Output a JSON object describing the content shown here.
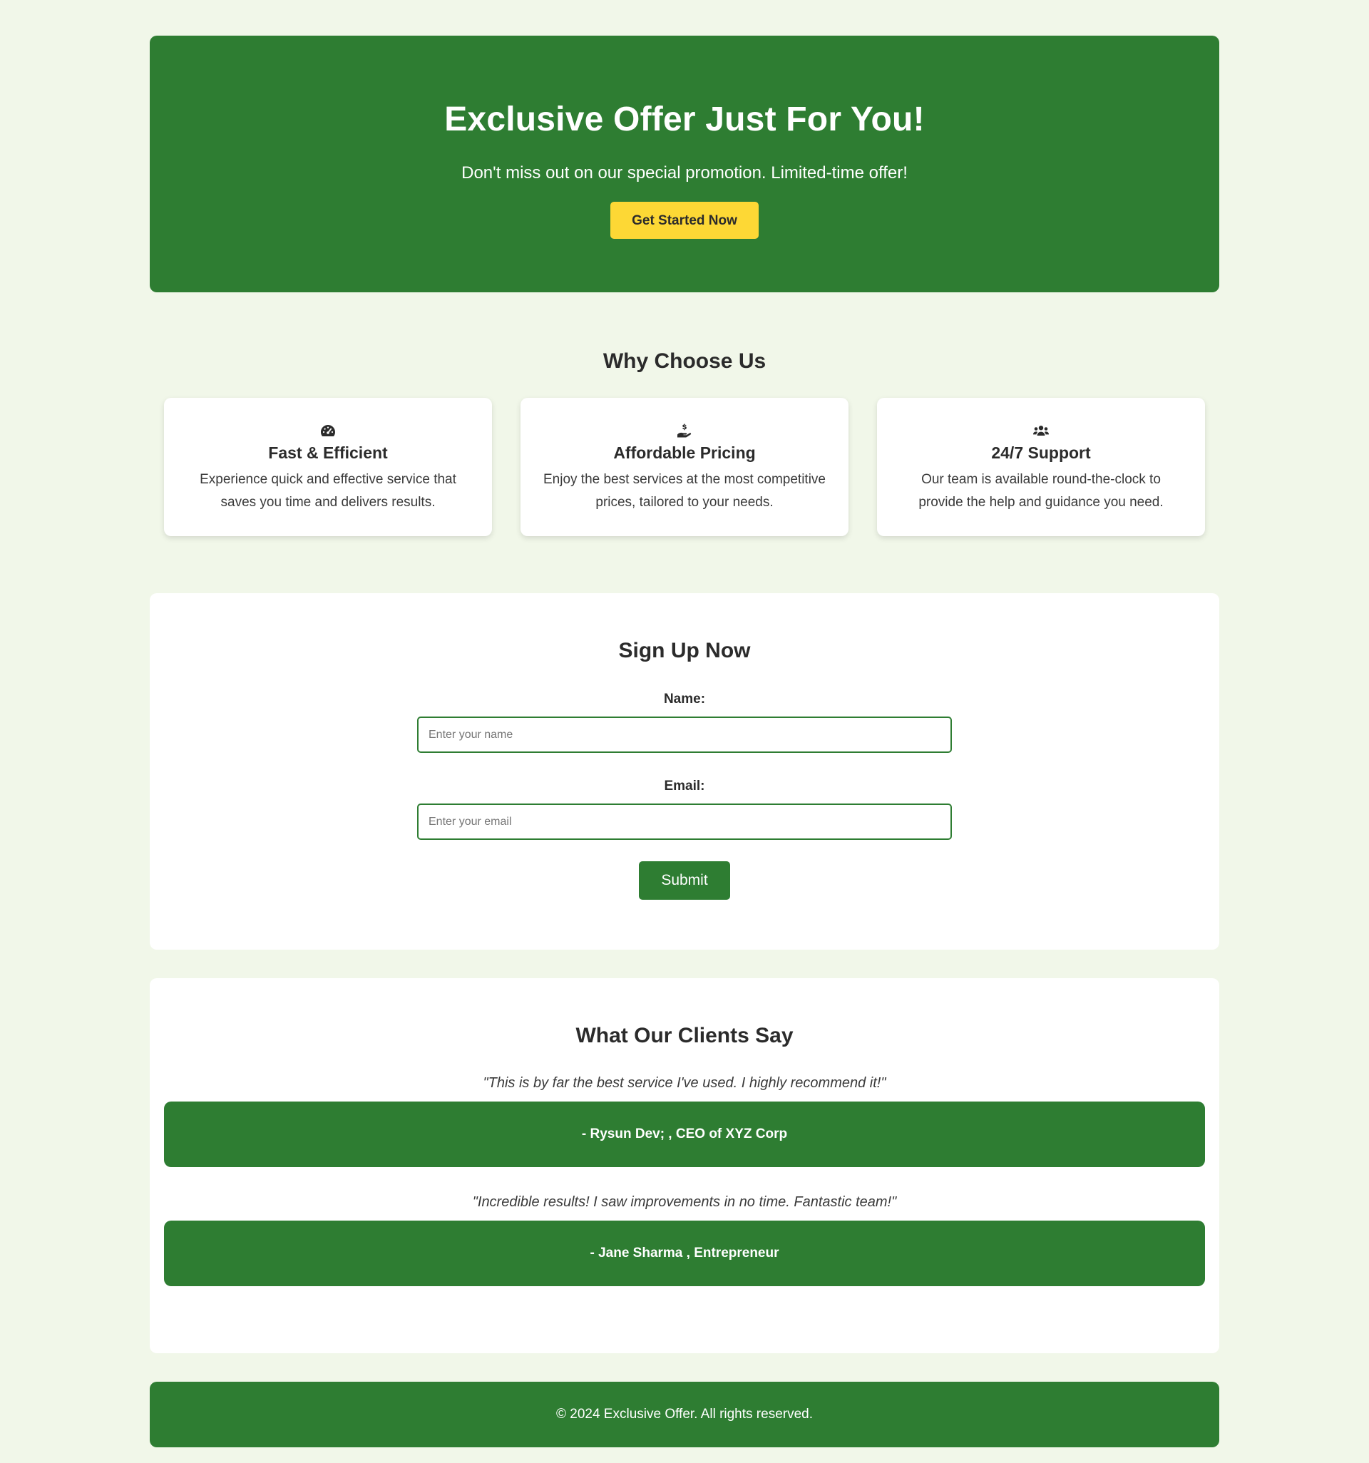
{
  "colors": {
    "page_background": "#f1f7e9",
    "brand_green": "#2e7d32",
    "accent_yellow": "#fdd835",
    "card_background": "#ffffff",
    "text_dark": "#2b2b2b"
  },
  "hero": {
    "title": "Exclusive Offer Just For You!",
    "subtitle": "Don't miss out on our special promotion. Limited-time offer!",
    "button_label": "Get Started Now"
  },
  "features": {
    "title": "Why Choose Us",
    "items": [
      {
        "icon": "tachometer-icon",
        "title": "Fast & Efficient",
        "text": "Experience quick and effective service that saves you time and delivers results."
      },
      {
        "icon": "hand-holding-dollar-icon",
        "title": "Affordable Pricing",
        "text": "Enjoy the best services at the most competitive prices, tailored to your needs."
      },
      {
        "icon": "users-icon",
        "title": "24/7 Support",
        "text": "Our team is available round-the-clock to provide the help and guidance you need."
      }
    ]
  },
  "signup": {
    "title": "Sign Up Now",
    "name_label": "Name:",
    "name_placeholder": "Enter your name",
    "name_value": "",
    "email_label": "Email:",
    "email_placeholder": "Enter your email",
    "email_value": "",
    "submit_label": "Submit"
  },
  "testimonials": {
    "title": "What Our Clients Say",
    "items": [
      {
        "quote": "\"This is by far the best service I've used. I highly recommend it!\"",
        "author": "- Rysun Dev; , CEO of XYZ Corp"
      },
      {
        "quote": "\"Incredible results! I saw improvements in no time. Fantastic team!\"",
        "author": "- Jane Sharma , Entrepreneur"
      }
    ]
  },
  "footer": {
    "text": "© 2024 Exclusive Offer. All rights reserved."
  }
}
